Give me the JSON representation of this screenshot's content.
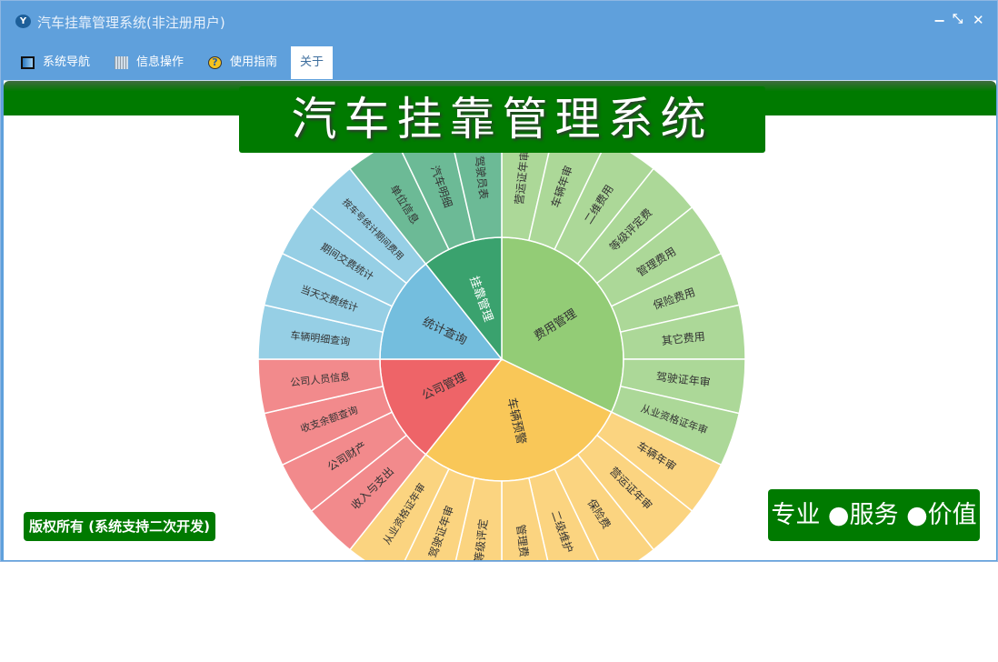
{
  "window": {
    "title": "汽车挂靠管理系统(非注册用户)",
    "app_icon": "Y",
    "controls": {
      "minimize": "−",
      "restore": "⤡",
      "close": "✕"
    }
  },
  "menu": [
    {
      "label": "系统导航",
      "icon": "window-icon"
    },
    {
      "label": "信息操作",
      "icon": "grid-icon"
    },
    {
      "label": "使用指南",
      "icon": "help-icon"
    },
    {
      "label": "关于",
      "icon": ""
    }
  ],
  "banner": {
    "title": "汽车挂靠管理系统"
  },
  "footer": {
    "copyright": "版权所有 (系统支持二次开发)",
    "slogan": "专业 ●服务 ●价值"
  },
  "colors": {
    "green": "#007a00",
    "window": "#5fa0dc"
  },
  "chart_data": {
    "type": "sunburst",
    "series": [
      {
        "name": "费用管理",
        "color": "#93cc76",
        "leaf_color": "#acd898",
        "text": "#333",
        "children": [
          "营运证年审",
          "车辆年审",
          "二维费用",
          "等级评定费",
          "管理费用",
          "保险费用",
          "其它费用",
          "驾驶证年审",
          "从业资格证年审"
        ]
      },
      {
        "name": "车辆预警",
        "color": "#f9c758",
        "leaf_color": "#fbd480",
        "text": "#333",
        "children": [
          "车辆年审",
          "营运证年审",
          "保险费",
          "二级维护",
          "管理费",
          "等级评定",
          "驾驶证年审",
          "从业资格证年审"
        ]
      },
      {
        "name": "公司管理",
        "color": "#ee6468",
        "leaf_color": "#f28a8c",
        "text": "#333",
        "children": [
          "收入与支出",
          "公司财产",
          "收支余额查询",
          "公司人员信息"
        ]
      },
      {
        "name": "统计查询",
        "color": "#74bede",
        "leaf_color": "#96cfe5",
        "text": "#333",
        "children": [
          "车辆明细查询",
          "当天交费统计",
          "期间交费统计",
          "按车号统计期间费用"
        ]
      },
      {
        "name": "挂靠管理",
        "color": "#3aa26e",
        "leaf_color": "#6cba96",
        "text": "#fff",
        "children": [
          "单位信息",
          "汽车明细",
          "驾驶员表"
        ]
      }
    ]
  }
}
